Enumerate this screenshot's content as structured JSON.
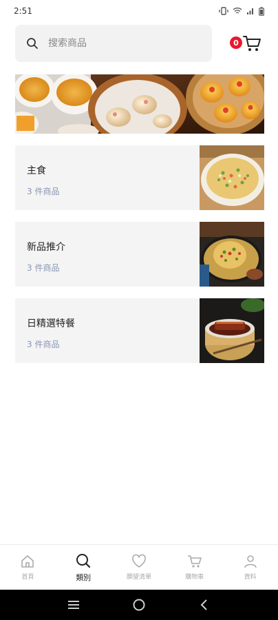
{
  "status_bar": {
    "time": "2:51"
  },
  "search": {
    "placeholder": "搜索商品"
  },
  "cart": {
    "count": "0"
  },
  "categories": [
    {
      "name": "主食",
      "count": "3 件商品"
    },
    {
      "name": "新品推介",
      "count": "3 件商品"
    },
    {
      "name": "日精選特餐",
      "count": "3 件商品"
    }
  ],
  "tabs": [
    {
      "label": "首頁",
      "icon": "home-icon"
    },
    {
      "label": "類別",
      "icon": "search-icon"
    },
    {
      "label": "願望清單",
      "icon": "heart-icon"
    },
    {
      "label": "購物車",
      "icon": "cart-icon"
    },
    {
      "label": "資料",
      "icon": "user-icon"
    }
  ],
  "colors": {
    "badge": "#e8192c",
    "label_muted": "#8a96b3"
  }
}
